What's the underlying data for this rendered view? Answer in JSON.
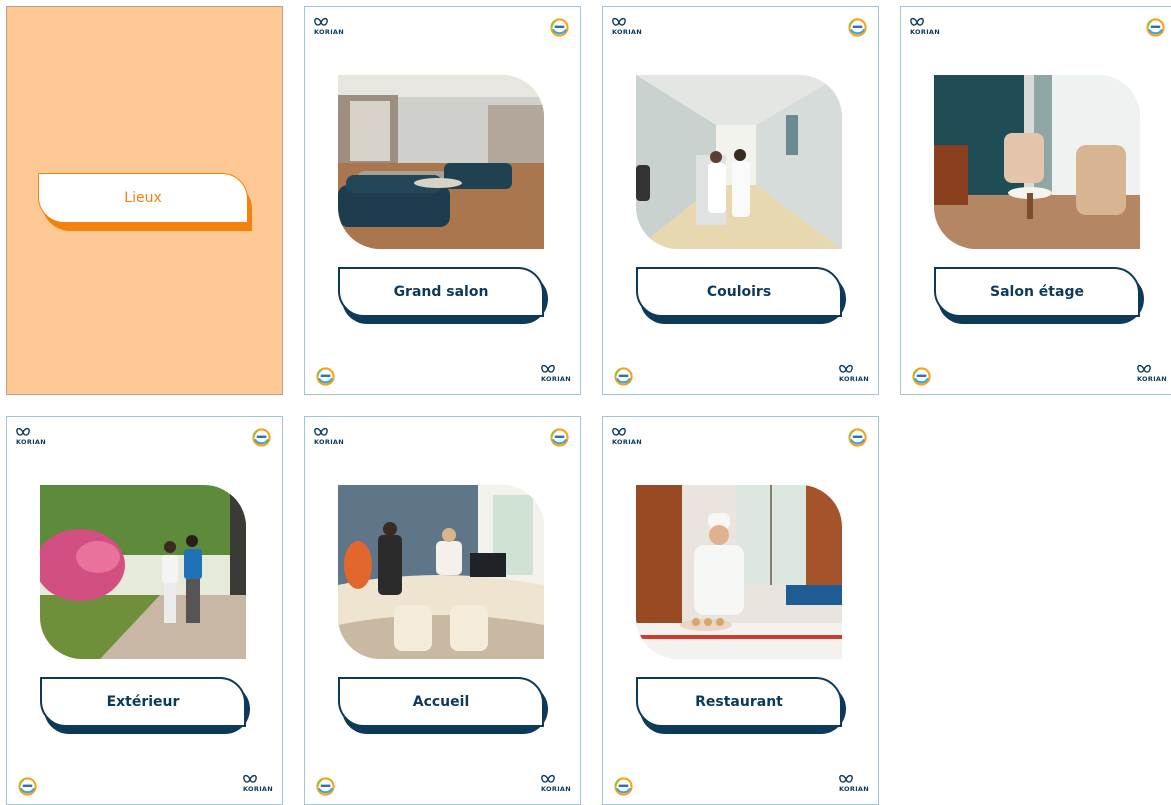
{
  "cover": {
    "title": "Lieux",
    "background_color": "#fdc894",
    "accent_color": "#f3810c"
  },
  "brand": {
    "logo_text": "KORIAN",
    "primary_color": "#0e3a5a"
  },
  "cards": [
    {
      "label": "Grand salon",
      "photo": "lounge-photo"
    },
    {
      "label": "Couloirs",
      "photo": "corridor-photo"
    },
    {
      "label": "Salon étage",
      "photo": "floor-lounge-photo"
    },
    {
      "label": "Extérieur",
      "photo": "garden-photo"
    },
    {
      "label": "Accueil",
      "photo": "reception-photo"
    },
    {
      "label": "Restaurant",
      "photo": "restaurant-photo"
    }
  ]
}
